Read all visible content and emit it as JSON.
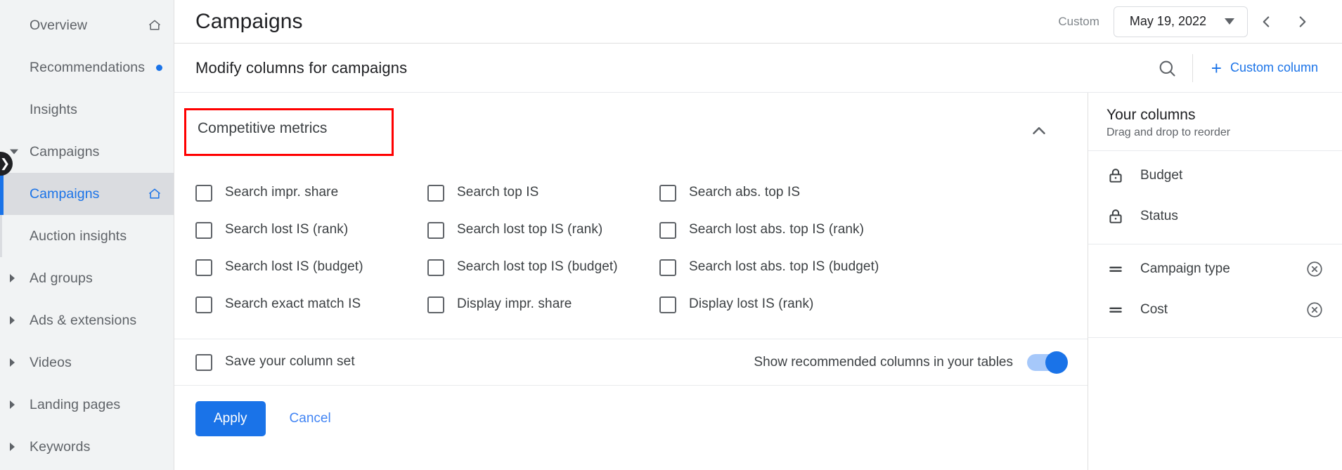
{
  "sidebar": {
    "items": [
      {
        "label": "Overview",
        "icon": "home-icon",
        "has_home": true,
        "has_dot": false,
        "caret": "none",
        "active": false,
        "sub": false
      },
      {
        "label": "Recommendations",
        "icon": "",
        "has_home": false,
        "has_dot": true,
        "caret": "none",
        "active": false,
        "sub": false
      },
      {
        "label": "Insights",
        "icon": "",
        "has_home": false,
        "has_dot": false,
        "caret": "none",
        "active": false,
        "sub": false
      },
      {
        "label": "Campaigns",
        "icon": "",
        "has_home": false,
        "has_dot": false,
        "caret": "down",
        "active": false,
        "sub": false
      },
      {
        "label": "Campaigns",
        "icon": "home-icon",
        "has_home": true,
        "has_dot": false,
        "caret": "none",
        "active": true,
        "sub": true
      },
      {
        "label": "Auction insights",
        "icon": "",
        "has_home": false,
        "has_dot": false,
        "caret": "none",
        "active": false,
        "sub": true
      },
      {
        "label": "Ad groups",
        "icon": "",
        "has_home": false,
        "has_dot": false,
        "caret": "right",
        "active": false,
        "sub": false
      },
      {
        "label": "Ads & extensions",
        "icon": "",
        "has_home": false,
        "has_dot": false,
        "caret": "right",
        "active": false,
        "sub": false
      },
      {
        "label": "Videos",
        "icon": "",
        "has_home": false,
        "has_dot": false,
        "caret": "right",
        "active": false,
        "sub": false
      },
      {
        "label": "Landing pages",
        "icon": "",
        "has_home": false,
        "has_dot": false,
        "caret": "right",
        "active": false,
        "sub": false
      },
      {
        "label": "Keywords",
        "icon": "",
        "has_home": false,
        "has_dot": false,
        "caret": "right",
        "active": false,
        "sub": false
      }
    ],
    "collapse_handle": "❯"
  },
  "topbar": {
    "page_title": "Campaigns",
    "date_range_label": "Custom",
    "date_value": "May 19, 2022",
    "prev_glyph": "‹",
    "next_glyph": "›"
  },
  "dialog": {
    "title": "Modify columns for campaigns",
    "search_icon": "search-icon",
    "custom_column_label": "Custom column",
    "custom_column_plus": "+",
    "section": {
      "title": "Competitive metrics",
      "collapsed": false,
      "highlight_color": "#ff0000"
    },
    "metrics": [
      {
        "label": "Search impr. share",
        "checked": false
      },
      {
        "label": "Search top IS",
        "checked": false
      },
      {
        "label": "Search abs. top IS",
        "checked": false
      },
      {
        "label": "Search lost IS (rank)",
        "checked": false
      },
      {
        "label": "Search lost top IS (rank)",
        "checked": false
      },
      {
        "label": "Search lost abs. top IS (rank)",
        "checked": false
      },
      {
        "label": "Search lost IS (budget)",
        "checked": false
      },
      {
        "label": "Search lost top IS (budget)",
        "checked": false
      },
      {
        "label": "Search lost abs. top IS (budget)",
        "checked": false
      },
      {
        "label": "Search exact match IS",
        "checked": false
      },
      {
        "label": "Display impr. share",
        "checked": false
      },
      {
        "label": "Display lost IS (rank)",
        "checked": false
      }
    ],
    "your_columns": {
      "title": "Your columns",
      "subtitle": "Drag and drop to reorder",
      "locked": [
        {
          "label": "Budget",
          "icon": "lock-icon"
        },
        {
          "label": "Status",
          "icon": "lock-icon"
        }
      ],
      "reorderable": [
        {
          "label": "Campaign type",
          "drag_icon": "drag-handle-icon",
          "remove_icon": "remove-circle-icon"
        },
        {
          "label": "Cost",
          "drag_icon": "drag-handle-icon",
          "remove_icon": "remove-circle-icon"
        }
      ]
    },
    "footer": {
      "save_column_set_label": "Save your column set",
      "save_column_set_checked": false,
      "show_recommended_label": "Show recommended columns in your tables",
      "show_recommended_on": true,
      "apply_label": "Apply",
      "cancel_label": "Cancel",
      "accent_color": "#1a73e8"
    }
  }
}
